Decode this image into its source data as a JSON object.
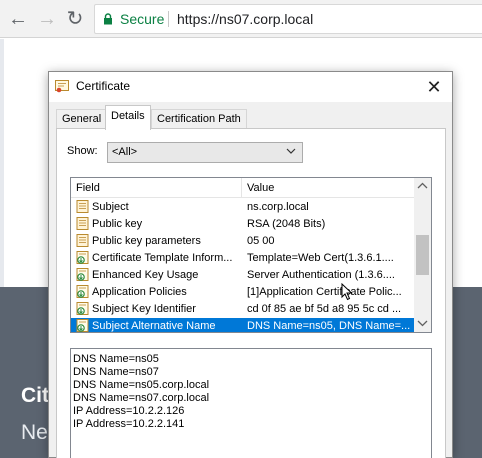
{
  "browser": {
    "secure_label": "Secure",
    "url_scheme": "https://",
    "url_host": "ns07.corp.local"
  },
  "page": {
    "heading_partial": "Cit",
    "subheading_partial": "Ne"
  },
  "dialog": {
    "title": "Certificate",
    "tabs": [
      {
        "label": "General",
        "active": false
      },
      {
        "label": "Details",
        "active": true
      },
      {
        "label": "Certification Path",
        "active": false
      }
    ],
    "show_label": "Show:",
    "show_value": "<All>",
    "columns": {
      "field": "Field",
      "value": "Value"
    },
    "rows": [
      {
        "field": "Subject",
        "value": "ns.corp.local",
        "icon": "cert-field-icon",
        "selected": false
      },
      {
        "field": "Public key",
        "value": "RSA (2048 Bits)",
        "icon": "cert-field-icon",
        "selected": false
      },
      {
        "field": "Public key parameters",
        "value": "05 00",
        "icon": "cert-field-icon",
        "selected": false
      },
      {
        "field": "Certificate Template Inform...",
        "value": "Template=Web Cert(1.3.6.1....",
        "icon": "cert-extension-icon",
        "selected": false
      },
      {
        "field": "Enhanced Key Usage",
        "value": "Server Authentication (1.3.6....",
        "icon": "cert-extension-icon",
        "selected": false
      },
      {
        "field": "Application Policies",
        "value": "[1]Application Certificate Polic...",
        "icon": "cert-extension-icon",
        "selected": false
      },
      {
        "field": "Subject Key Identifier",
        "value": "cd 0f 85 ae bf 5d a8 95 5c cd ...",
        "icon": "cert-extension-icon",
        "selected": false
      },
      {
        "field": "Subject Alternative Name",
        "value": "DNS Name=ns05, DNS Name=...",
        "icon": "cert-extension-icon",
        "selected": true
      }
    ],
    "value_lines": [
      "DNS Name=ns05",
      "DNS Name=ns07",
      "DNS Name=ns05.corp.local",
      "DNS Name=ns07.corp.local",
      "IP Address=10.2.2.126",
      "IP Address=10.2.2.141"
    ]
  },
  "colors": {
    "secure_green": "#0b8043",
    "selection_blue": "#0078d7",
    "page_band": "#5b6470"
  }
}
